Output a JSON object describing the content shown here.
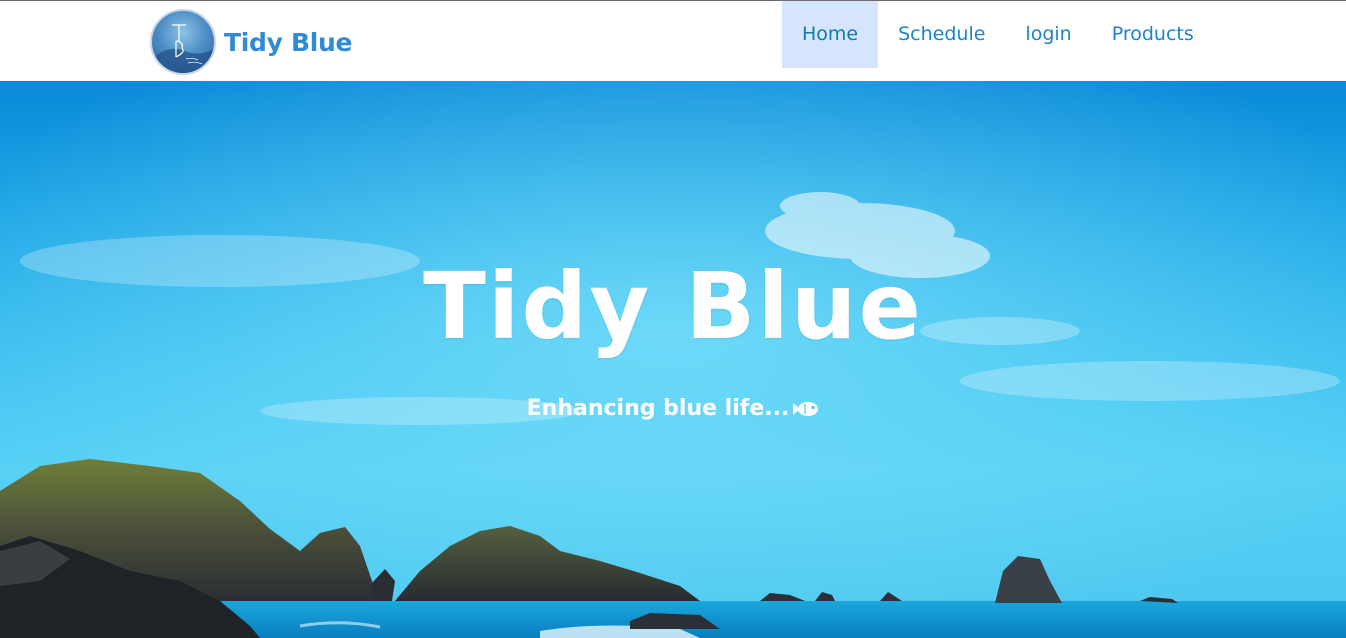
{
  "header": {
    "brand_name": "Tidy Blue",
    "logo_icon": "tidy-blue-logo",
    "nav": [
      {
        "label": "Home",
        "active": true
      },
      {
        "label": "Schedule",
        "active": false
      },
      {
        "label": "login",
        "active": false
      },
      {
        "label": "Products",
        "active": false
      }
    ]
  },
  "hero": {
    "title": "Tidy Blue",
    "subtitle": "Enhancing blue life...",
    "subtitle_icon": "fish-icon",
    "background": "ocean-coast-image"
  },
  "colors": {
    "brand": "#2f8ad8",
    "nav_text": "#1e84c8",
    "nav_active_bg": "#d4e5fd",
    "hero_text": "#ffffff"
  }
}
